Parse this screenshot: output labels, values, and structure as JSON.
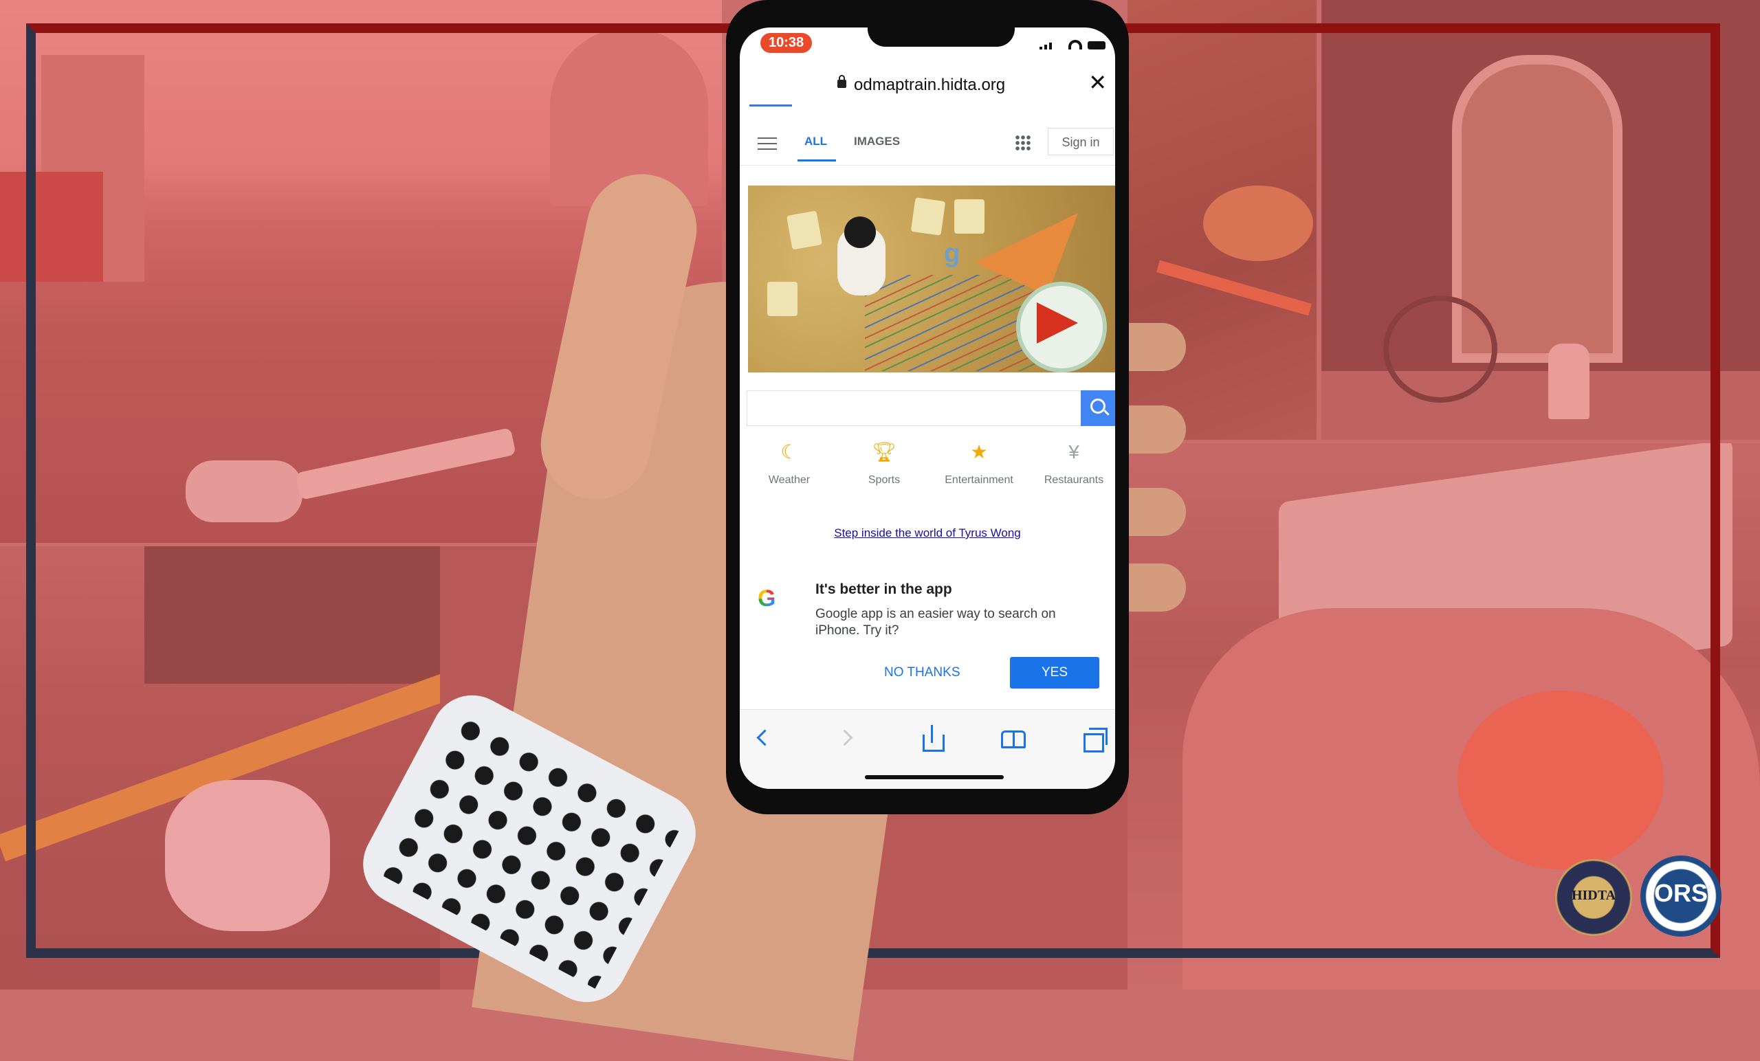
{
  "phone": {
    "status_time": "10:38",
    "url": "odmaptrain.hidta.org",
    "nav": {
      "tab_all": "ALL",
      "tab_images": "IMAGES",
      "sign_in": "Sign in"
    },
    "categories": [
      {
        "label": "Weather",
        "icon": "moon-icon",
        "color": "#f2a900"
      },
      {
        "label": "Sports",
        "icon": "trophy-icon",
        "color": "#f2a900"
      },
      {
        "label": "Entertainment",
        "icon": "star-icon",
        "color": "#f2a900"
      },
      {
        "label": "Restaurants",
        "icon": "fork-knife-icon",
        "color": "#9aa0a6"
      }
    ],
    "doodle_link": "Step inside the world of Tyrus Wong",
    "promo": {
      "title": "It's better in the app",
      "body": "Google app is an easier way to search on iPhone. Try it?",
      "no_thanks": "NO THANKS",
      "yes": "YES"
    }
  },
  "seals": {
    "left": "HIDTA",
    "right": "ORS"
  },
  "colors": {
    "google_blue": "#1a73e8",
    "time_badge": "#e94a2a",
    "overlay": "#eb5a5a"
  }
}
